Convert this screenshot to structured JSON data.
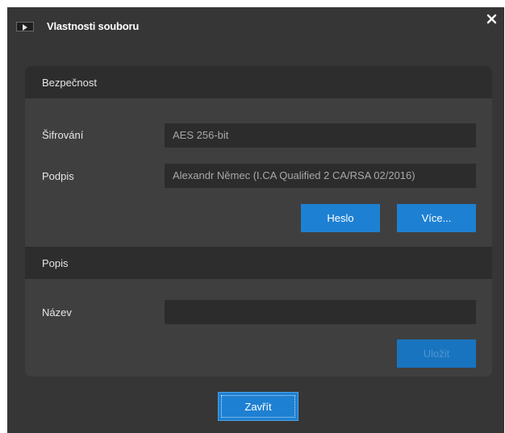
{
  "window": {
    "title": "Vlastnosti souboru",
    "close_icon": "close-icon"
  },
  "security": {
    "header": "Bezpečnost",
    "encryption_label": "Šifrování",
    "encryption_value": "AES 256-bit",
    "signature_label": "Podpis",
    "signature_value": "Alexandr Němec (I.CA Qualified 2 CA/RSA 02/2016)",
    "password_button": "Heslo",
    "more_button": "Více..."
  },
  "description": {
    "header": "Popis",
    "name_label": "Název",
    "name_value": "",
    "save_button": "Uložit"
  },
  "footer": {
    "close_button": "Zavřít"
  },
  "colors": {
    "dialog_bg": "#363636",
    "panel_bg": "#3f3f3f",
    "header_bg": "#2d2d2d",
    "accent": "#1e80d2"
  }
}
